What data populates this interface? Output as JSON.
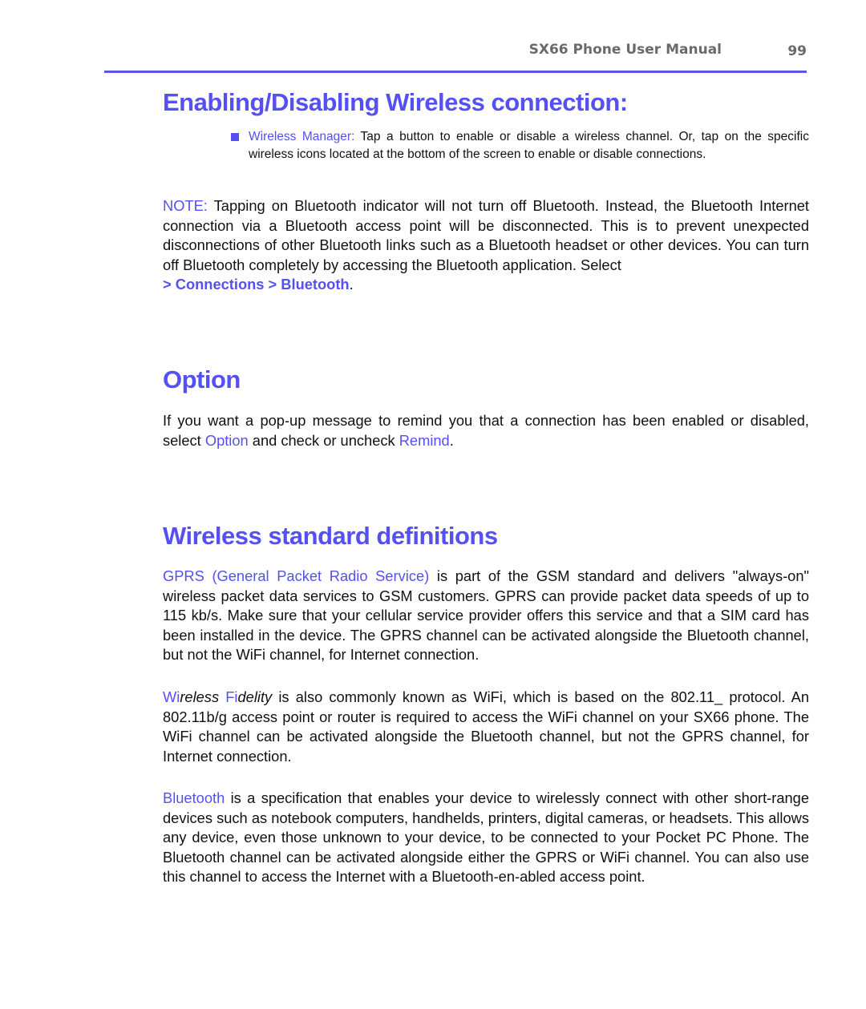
{
  "header": {
    "title": "SX66 Phone User Manual",
    "page_number": "99",
    "rule_color": "#5b55f0"
  },
  "accent_color": "#5550f2",
  "sections": {
    "enabling": {
      "heading": "Enabling/Disabling Wireless connection:",
      "bullet": {
        "term": "Wireless Manager:",
        "text": " Tap a button to enable or disable a wireless channel. Or, tap on the specific wireless icons located at the bottom of the screen to enable or disable connections."
      },
      "note": {
        "label": "NOTE:",
        "text": " Tapping on Bluetooth indicator will not turn off Bluetooth. Instead, the Bluetooth Internet connection via a Bluetooth access point will be disconnected. This is to prevent unexpected disconnections of other Bluetooth links such as a Bluetooth headset or other devices. You can turn off Bluetooth completely by accessing the Bluetooth application. Select",
        "path": "> Connections > Bluetooth",
        "end": "."
      }
    },
    "option": {
      "heading": "Option",
      "text_before": "If you want a pop-up message to remind you that a connection has been enabled or disabled, select ",
      "option_link": "Option",
      "text_middle": " and check or uncheck ",
      "remind_link": "Remind",
      "text_end": "."
    },
    "definitions": {
      "heading": "Wireless standard definitions",
      "gprs": {
        "term": "GPRS (General Packet Radio Service)",
        "text": " is part of the GSM standard and delivers \"always-on\" wireless packet data services to GSM customers. GPRS can provide packet data speeds of up to 115 kb/s. Make sure that your cellular service provider offers this service and that a SIM card has been installed in the device. The GPRS channel can be activated alongside the Bluetooth channel, but not the WiFi channel, for Internet connection."
      },
      "wifi": {
        "wi": "Wi",
        "reless": "reless ",
        "fi": "Fi",
        "delity": "delity",
        "text": " is also commonly known as WiFi, which is based on the 802.11_ protocol. An 802.11b/g access point or router is required to access the WiFi channel on your SX66 phone. The WiFi channel can be activated alongside the Bluetooth channel, but not the GPRS channel, for Internet connection."
      },
      "bluetooth": {
        "term": "Bluetooth",
        "text": " is a specification that enables your device to wirelessly connect with other short-range devices such as notebook computers, handhelds, printers, digital cameras, or headsets. This allows any device, even those unknown to your device, to be connected to your Pocket PC Phone. The Bluetooth channel can be activated alongside either the GPRS or WiFi channel. You can also use this channel to access the Internet with a Bluetooth-en-abled access point."
      }
    }
  }
}
